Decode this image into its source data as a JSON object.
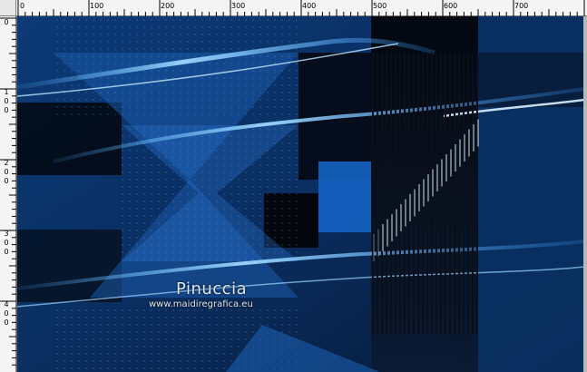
{
  "ruler": {
    "top_labels": [
      "0",
      "100",
      "200",
      "300",
      "400",
      "500",
      "600",
      "700"
    ],
    "left_labels": [
      [
        "0"
      ],
      [
        "1",
        "0",
        "0"
      ],
      [
        "2",
        "0",
        "0"
      ],
      [
        "3",
        "0",
        "0"
      ],
      [
        "4",
        "0",
        "0"
      ]
    ]
  },
  "watermark": {
    "name": "Pinuccia",
    "url": "www.maidiregrafica.eu"
  },
  "colors": {
    "deep_blue": "#0a2b55",
    "bright_blue": "#2f8fff",
    "black": "#05070c"
  }
}
